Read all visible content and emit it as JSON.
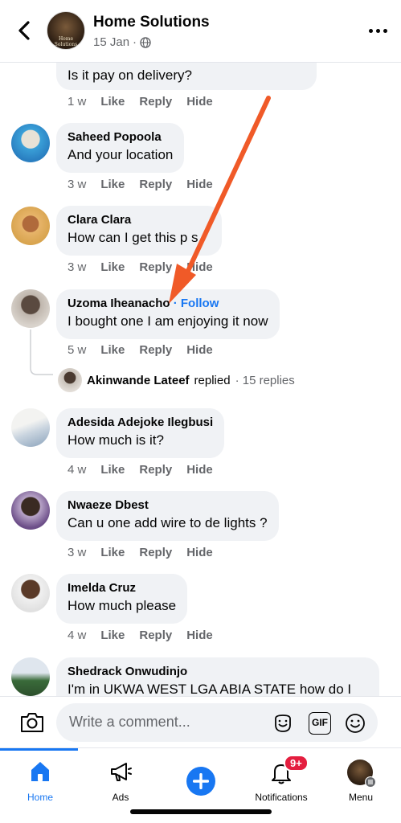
{
  "header": {
    "page_name": "Home Solutions",
    "date": "15 Jan",
    "date_separator": "·",
    "avatar_text": "Home Solutions",
    "back_icon": "chevron-left-icon",
    "more_icon": "more-icon"
  },
  "comments": [
    {
      "name": "",
      "text": "Is it pay on delivery?",
      "time": "1 w",
      "like": "Like",
      "reply": "Reply",
      "hide": "Hide"
    },
    {
      "name": "Saheed Popoola",
      "text": "And your  location",
      "time": "3 w",
      "like": "Like",
      "reply": "Reply",
      "hide": "Hide"
    },
    {
      "name": "Clara Clara",
      "text": "How can I get this p s",
      "time": "3 w",
      "like": "Like",
      "reply": "Reply",
      "hide": "Hide"
    },
    {
      "name": "Uzoma Iheanacho",
      "follow": "· Follow",
      "text": "I bought one I am enjoying it now",
      "time": "5 w",
      "like": "Like",
      "reply": "Reply",
      "hide": "Hide",
      "reply_summary": {
        "name": "Akinwande Lateef",
        "action": "replied",
        "count": "· 15 replies"
      }
    },
    {
      "name": "Adesida Adejoke Ilegbusi",
      "text": "How much is it?",
      "time": "4 w",
      "like": "Like",
      "reply": "Reply",
      "hide": "Hide"
    },
    {
      "name": "Nwaeze Dbest",
      "text": "Can u one add wire to de lights ?",
      "time": "3 w",
      "like": "Like",
      "reply": "Reply",
      "hide": "Hide"
    },
    {
      "name": "Imelda Cruz",
      "text": "How much please",
      "time": "4 w",
      "like": "Like",
      "reply": "Reply",
      "hide": "Hide"
    },
    {
      "name": "Shedrack Onwudinjo",
      "text": "I'm in UKWA WEST LGA ABIA STATE how do I"
    }
  ],
  "composer": {
    "placeholder": "Write a comment...",
    "gif_label": "GIF"
  },
  "nav": {
    "items": [
      {
        "label": "Home",
        "icon": "home-icon"
      },
      {
        "label": "Ads",
        "icon": "megaphone-icon"
      },
      {
        "label": "",
        "icon": "plus-icon"
      },
      {
        "label": "Notifications",
        "icon": "bell-icon",
        "badge": "9+"
      },
      {
        "label": "Menu",
        "icon": "menu-avatar-icon"
      }
    ]
  },
  "colors": {
    "accent": "#1877f2",
    "annotation_arrow": "#f05a28",
    "bubble": "#f0f2f5",
    "badge": "#e41e3f"
  }
}
